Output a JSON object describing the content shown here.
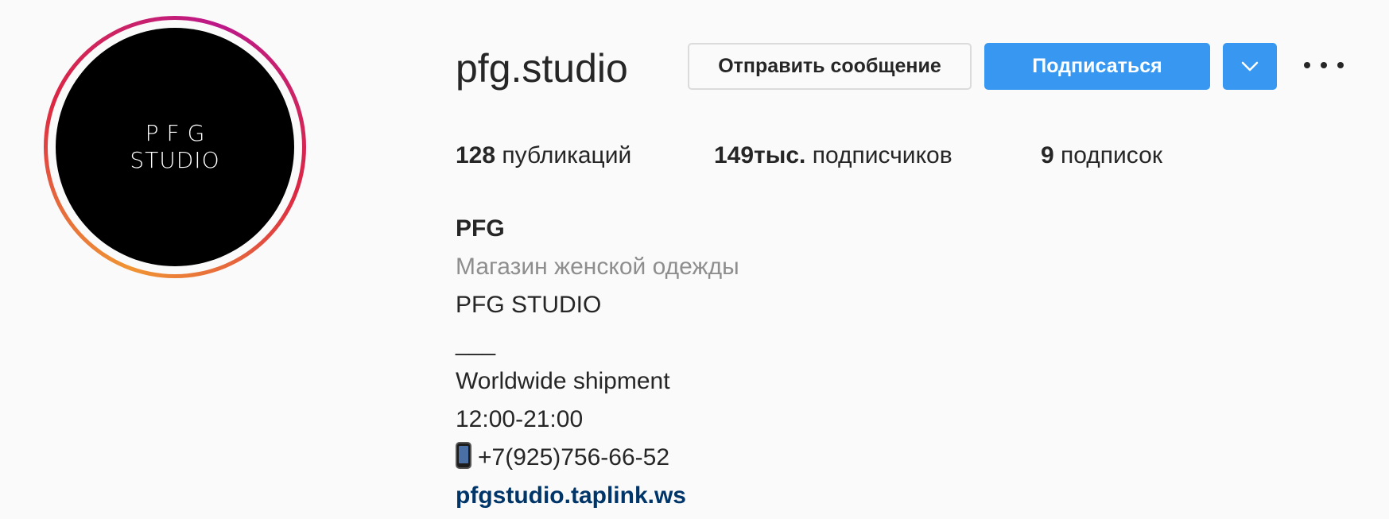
{
  "profile": {
    "avatar_logo_line1": "PFG",
    "avatar_logo_line2": "STUDIO",
    "username": "pfg.studio"
  },
  "actions": {
    "message_label": "Отправить сообщение",
    "follow_label": "Подписаться",
    "dropdown_icon": "chevron-down-icon",
    "more_icon": "more-options-icon",
    "follow_color": "#3897f0"
  },
  "stats": {
    "posts_count": "128",
    "posts_label": "публикаций",
    "followers_count": "149тыс.",
    "followers_label": "подписчиков",
    "following_count": "9",
    "following_label": "подписок"
  },
  "bio": {
    "name": "PFG",
    "category": "Магазин женской одежды",
    "line1": "PFG STUDIO",
    "line2": "___",
    "line3": "Worldwide shipment",
    "line4": "12:00-21:00",
    "phone_icon": "mobile-phone-icon",
    "phone": "+7(925)756-66-52",
    "link": "pfgstudio.taplink.ws"
  }
}
